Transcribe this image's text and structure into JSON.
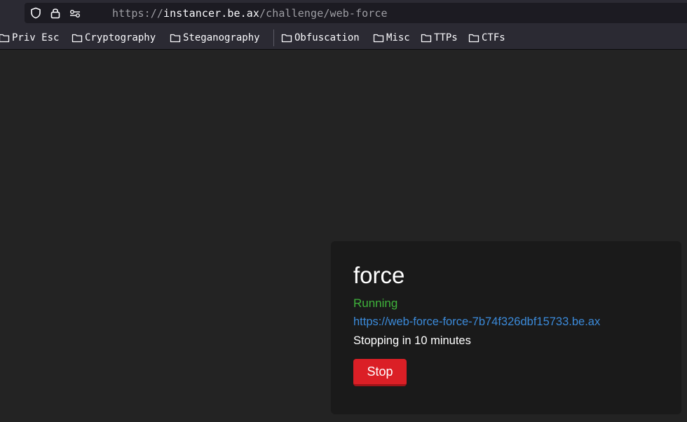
{
  "browser": {
    "url_scheme": "https://",
    "url_host": "instancer.be.ax",
    "url_path": "/challenge/web-force",
    "icons": [
      "shield-icon",
      "lock-icon",
      "permissions-icon"
    ]
  },
  "bookmarks": [
    {
      "label": "Priv Esc",
      "icon": "folder-icon"
    },
    {
      "label": "Cryptography",
      "icon": "folder-icon"
    },
    {
      "label": "Steganography",
      "icon": "folder-icon"
    },
    {
      "label": "Obfuscation",
      "icon": "folder-icon"
    },
    {
      "label": "Misc",
      "icon": "folder-icon"
    },
    {
      "label": "TTPs",
      "icon": "folder-icon"
    },
    {
      "label": "CTFs",
      "icon": "folder-icon"
    }
  ],
  "instance": {
    "name": "force",
    "status": "Running",
    "status_color": "#3fb33b",
    "url": "https://web-force-force-7b74f326dbf15733.be.ax",
    "expiry_text": "Stopping in 10 minutes",
    "stop_label": "Stop",
    "stop_color": "#db1f26"
  }
}
